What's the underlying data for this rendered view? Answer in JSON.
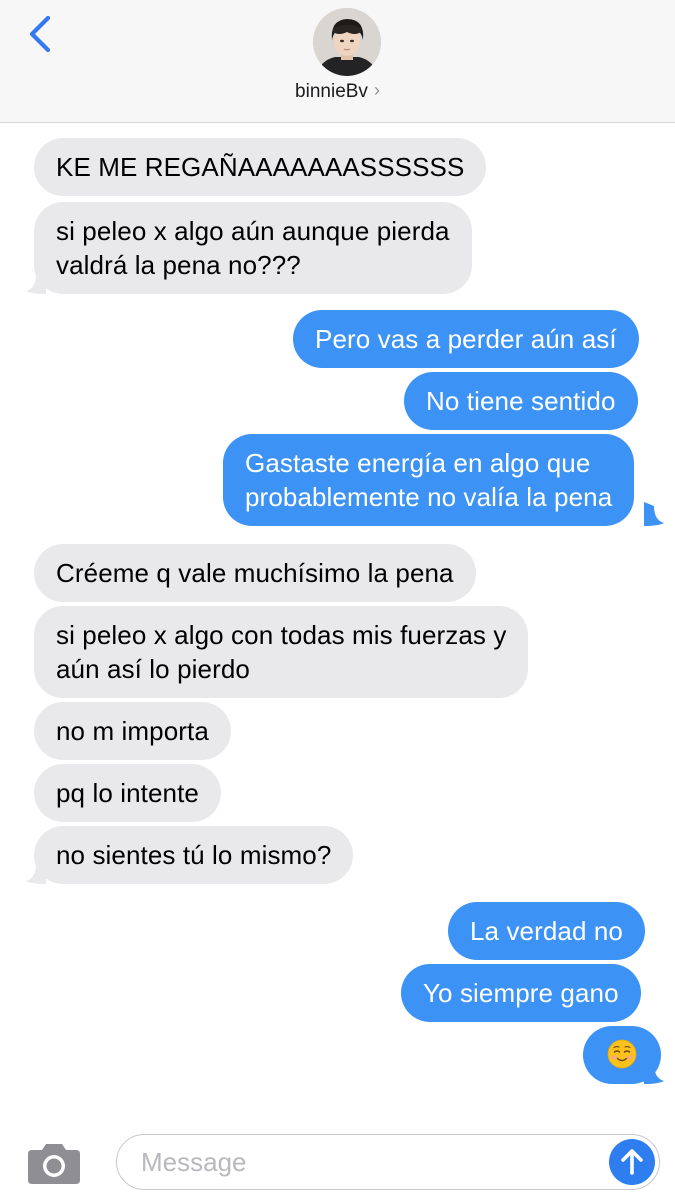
{
  "header": {
    "contact_name": "binnieBv",
    "chevron": "›",
    "back_icon": "chevron-left-icon",
    "accent_color": "#3478f6"
  },
  "messages": [
    {
      "from": "received",
      "text": "KE ME REGAÑAAAAAAASSSSSS"
    },
    {
      "from": "received",
      "text_lines": [
        "si peleo x algo aún aunque pierda",
        "valdrá la pena no???"
      ]
    },
    {
      "from": "sent",
      "text": "Pero vas a perder aún así"
    },
    {
      "from": "sent",
      "text": "No tiene sentido"
    },
    {
      "from": "sent",
      "text_lines": [
        "Gastaste energía en algo que",
        "probablemente no valía la pena"
      ]
    },
    {
      "from": "received",
      "text": "Créeme q vale muchísimo la pena"
    },
    {
      "from": "received",
      "text_lines": [
        "si peleo x algo con todas mis fuerzas y",
        "aún así lo pierdo"
      ]
    },
    {
      "from": "received",
      "text": "no m importa"
    },
    {
      "from": "received",
      "text": "pq lo intente"
    },
    {
      "from": "received",
      "text": "no sientes tú lo mismo?"
    },
    {
      "from": "sent",
      "text": "La verdad no"
    },
    {
      "from": "sent",
      "text": "Yo siempre gano"
    },
    {
      "from": "sent",
      "emoji": "smiling-face-emoji"
    }
  ],
  "colors": {
    "sent_bubble": "#3d93f5",
    "received_bubble": "#e9e9eb",
    "send_button": "#2f7ef0"
  },
  "input": {
    "placeholder": "Message",
    "value": ""
  },
  "icons": {
    "camera": "camera-icon",
    "send": "arrow-up-icon"
  }
}
